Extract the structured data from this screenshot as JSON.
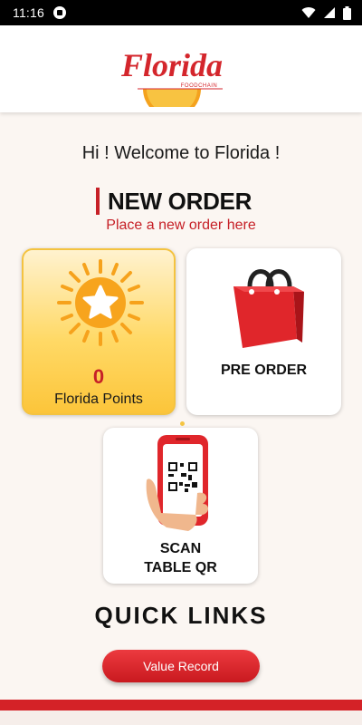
{
  "status_bar": {
    "time": "11:16",
    "icons": [
      "notification-icon",
      "wifi-icon",
      "signal-icon",
      "battery-icon"
    ]
  },
  "header": {
    "logo_text": "Florida",
    "logo_subtext": "FOODCHAIN"
  },
  "welcome": "Hi ! Welcome to Florida !",
  "new_order": {
    "title": "NEW ORDER",
    "subtitle": "Place a new order here"
  },
  "cards": {
    "points": {
      "value": "0",
      "label": "Florida Points",
      "icon": "sun-star-icon"
    },
    "preorder": {
      "label": "PRE ORDER",
      "icon": "shopping-bag-icon"
    },
    "scan": {
      "label_line1": "SCAN",
      "label_line2": "TABLE QR",
      "icon": "phone-qr-icon"
    }
  },
  "quick_links": {
    "title": "QUICK LINKS",
    "value_record_label": "Value Record"
  },
  "colors": {
    "brand_red": "#c62027",
    "points_yellow": "#fcc53a",
    "background": "#fbf6f2"
  }
}
